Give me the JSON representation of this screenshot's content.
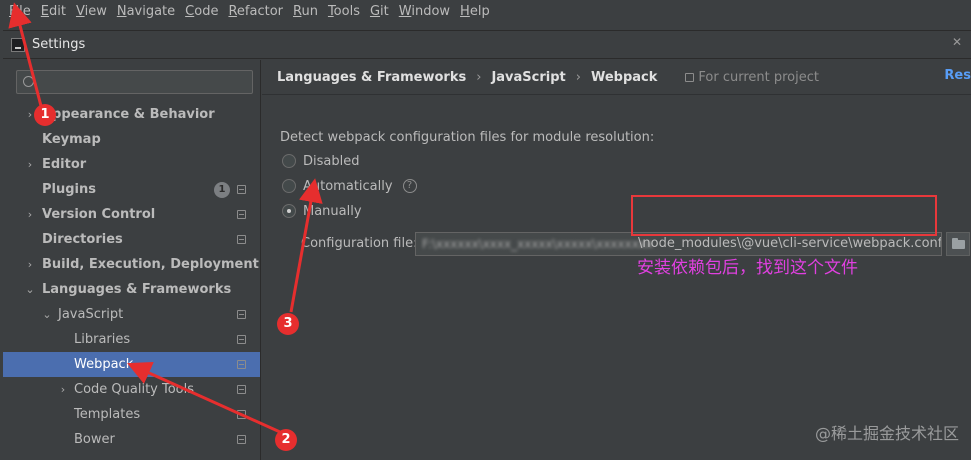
{
  "menubar": {
    "items": [
      {
        "mnemonic": "F",
        "rest": "ile"
      },
      {
        "mnemonic": "E",
        "rest": "dit"
      },
      {
        "mnemonic": "V",
        "rest": "iew"
      },
      {
        "mnemonic": "N",
        "rest": "avigate"
      },
      {
        "mnemonic": "C",
        "rest": "ode"
      },
      {
        "mnemonic": "R",
        "rest": "efactor"
      },
      {
        "mnemonic": "R",
        "rest": "un"
      },
      {
        "mnemonic": "T",
        "rest": "ools"
      },
      {
        "mnemonic": "G",
        "rest": "it"
      },
      {
        "mnemonic": "W",
        "rest": "indow"
      },
      {
        "mnemonic": "H",
        "rest": "elp"
      }
    ]
  },
  "window": {
    "title": "Settings",
    "close_glyph": "✕"
  },
  "sidebar": {
    "search_placeholder": "",
    "items": [
      {
        "label": "Appearance & Behavior",
        "arrow": "›"
      },
      {
        "label": "Keymap"
      },
      {
        "label": "Editor",
        "arrow": "›"
      },
      {
        "label": "Plugins",
        "badge": "1"
      },
      {
        "label": "Version Control",
        "arrow": "›"
      },
      {
        "label": "Directories"
      },
      {
        "label": "Build, Execution, Deployment",
        "arrow": "›"
      },
      {
        "label": "Languages & Frameworks",
        "arrow": "⌄"
      },
      {
        "label": "JavaScript",
        "arrow": "⌄"
      },
      {
        "label": "Libraries"
      },
      {
        "label": "Webpack"
      },
      {
        "label": "Code Quality Tools",
        "arrow": "›"
      },
      {
        "label": "Templates"
      },
      {
        "label": "Bower"
      }
    ]
  },
  "main": {
    "breadcrumb": [
      "Languages & Frameworks",
      "JavaScript",
      "Webpack"
    ],
    "breadcrumb_sep": "›",
    "project_note": "For current project",
    "reset_label": "Res",
    "description": "Detect webpack configuration files for module resolution:",
    "options": {
      "disabled": "Disabled",
      "automatically": "Automatically",
      "manually": "Manually",
      "selected": "Manually"
    },
    "help_glyph": "?",
    "config_label": "Configuration file:",
    "config_value_obscured": "F:\\xxxxxx\\xxxx_xxxxx\\xxxxx\\xxxxxxxx",
    "config_value_visible": "\\node_modules\\@vue\\cli-service\\webpack.config.js"
  },
  "annotations": {
    "note": "安装依赖包后，找到这个文件",
    "numbers": [
      "1",
      "2",
      "3"
    ],
    "box_color": "#e8383b",
    "note_color": "#e040e0"
  },
  "watermark": "@稀土掘金技术社区",
  "colors": {
    "selection": "#4b6eaf",
    "link": "#589df6",
    "background": "#3c3f41"
  }
}
